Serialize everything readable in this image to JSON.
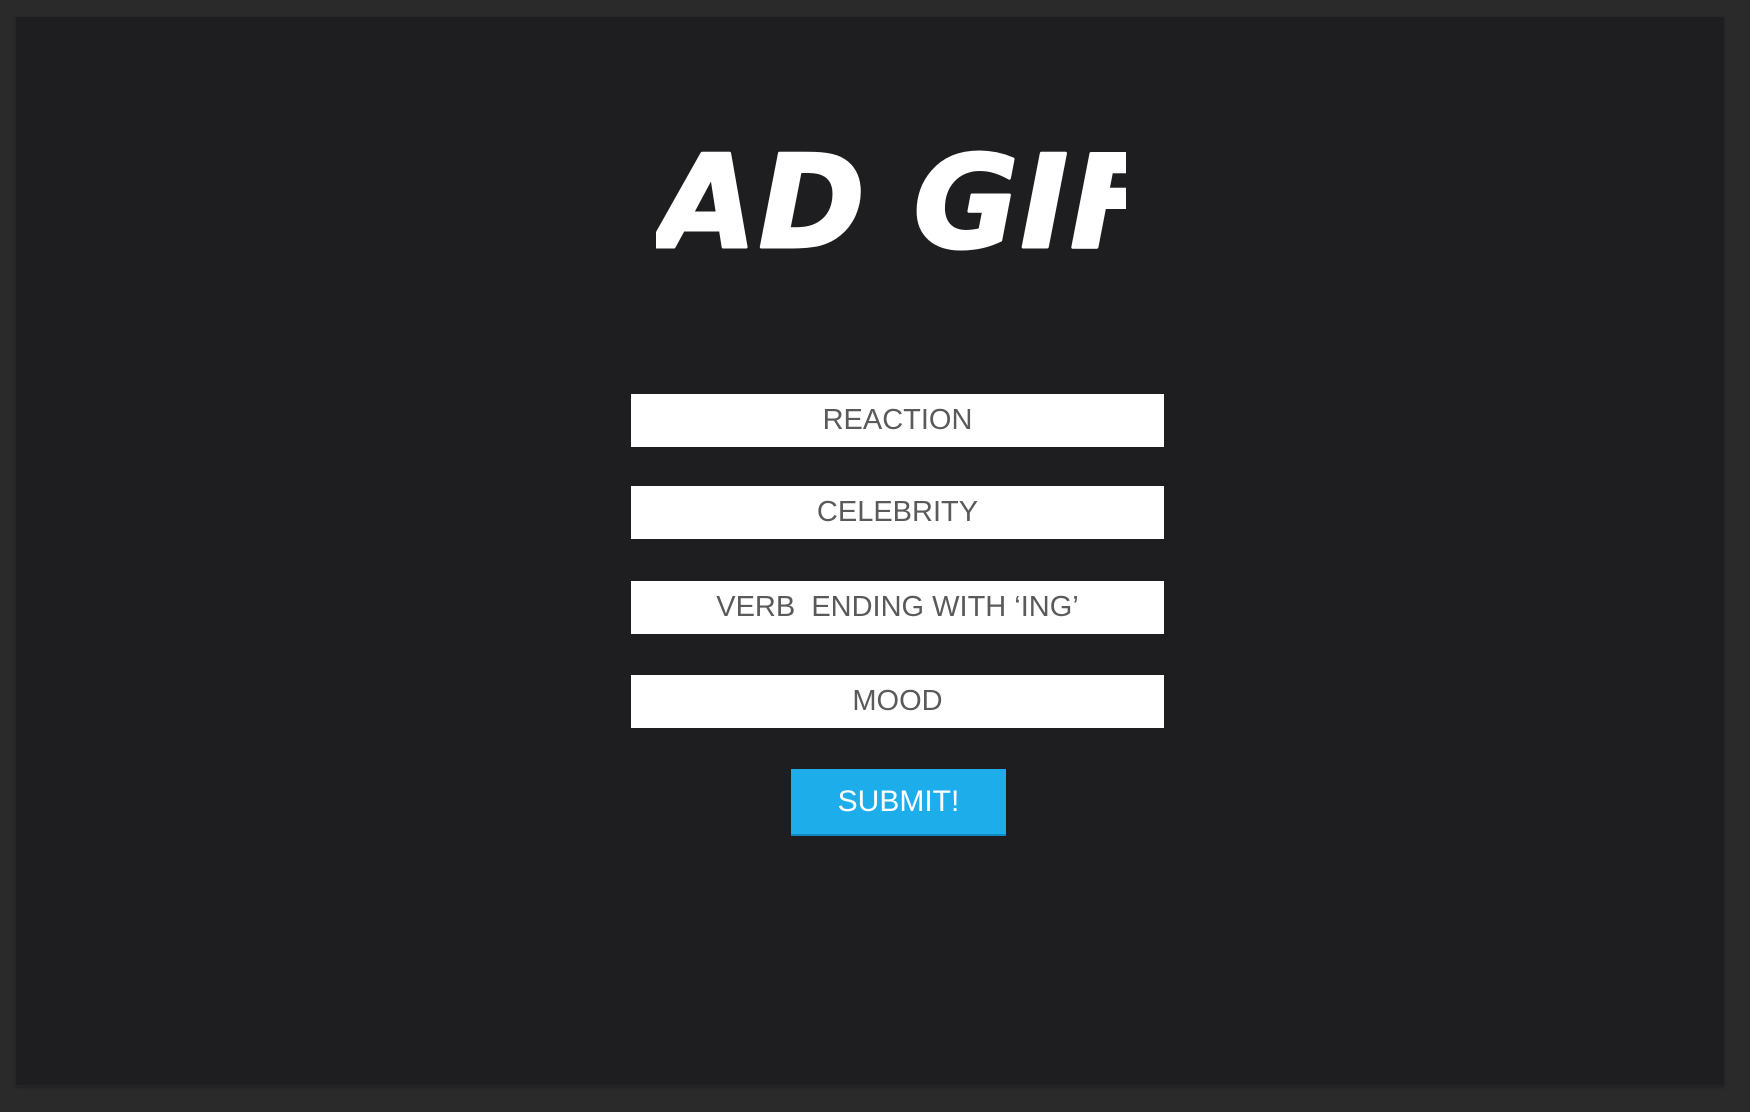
{
  "app": {
    "logo_text": "MAD GIFS"
  },
  "form": {
    "fields": [
      {
        "placeholder": "REACTION",
        "value": ""
      },
      {
        "placeholder": "CELEBRITY",
        "value": ""
      },
      {
        "placeholder": "VERB  ENDING WITH ‘ING’",
        "value": ""
      },
      {
        "placeholder": "MOOD",
        "value": ""
      }
    ],
    "submit_label": "SUBMIT!"
  },
  "colors": {
    "background": "#1e1e20",
    "outer_background": "#2a2a2b",
    "field_background": "#ffffff",
    "field_text": "#5a5a5a",
    "accent": "#1eadeb",
    "logo": "#ffffff"
  }
}
